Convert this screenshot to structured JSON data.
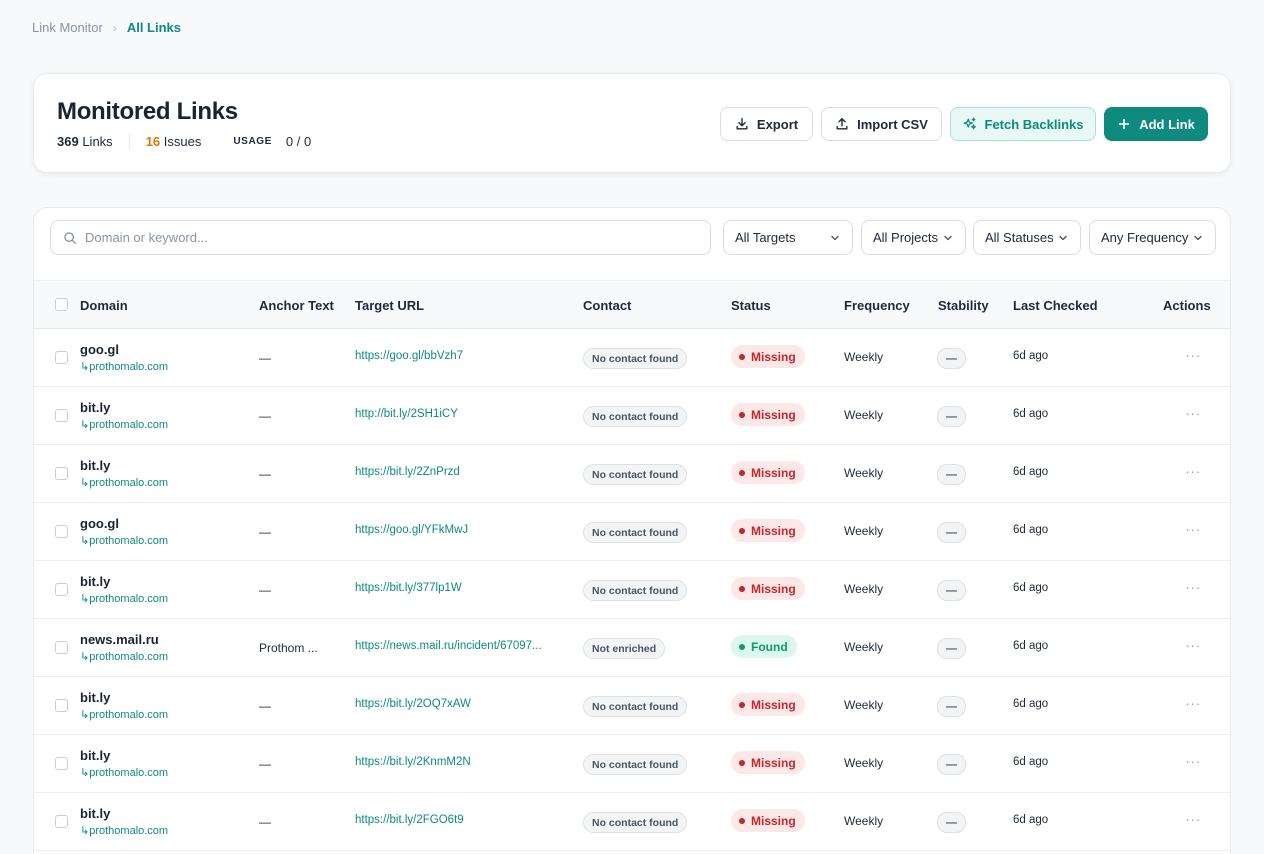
{
  "breadcrumb": {
    "root": "Link Monitor",
    "separator": "›",
    "current": "All Links"
  },
  "header": {
    "title": "Monitored Links",
    "links_count": "369",
    "links_label": "Links",
    "issues_count": "16",
    "issues_label": "Issues",
    "usage_label": "USAGE",
    "usage_value": "0 / 0"
  },
  "actions": {
    "export": "Export",
    "import": "Import CSV",
    "fetch": "Fetch Backlinks",
    "add": "Add Link"
  },
  "filters": {
    "search_placeholder": "Domain or keyword...",
    "targets": "All Targets",
    "projects": "All Projects",
    "statuses": "All Statuses",
    "frequency": "Any Frequency"
  },
  "table": {
    "columns": [
      "Domain",
      "Anchor Text",
      "Target URL",
      "Contact",
      "Status",
      "Frequency",
      "Stability",
      "Last Checked",
      "Actions"
    ],
    "rows": [
      {
        "domain": "goo.gl",
        "sub": "↳prothomalo.com",
        "anchor": "—",
        "target": "https://goo.gl/bbVzh7",
        "contact": "No contact found",
        "status": "Missing",
        "status_type": "missing",
        "frequency": "Weekly",
        "stability": "—",
        "checked": "6d ago"
      },
      {
        "domain": "bit.ly",
        "sub": "↳prothomalo.com",
        "anchor": "—",
        "target": "http://bit.ly/2SH1iCY",
        "contact": "No contact found",
        "status": "Missing",
        "status_type": "missing",
        "frequency": "Weekly",
        "stability": "—",
        "checked": "6d ago"
      },
      {
        "domain": "bit.ly",
        "sub": "↳prothomalo.com",
        "anchor": "—",
        "target": "https://bit.ly/2ZnPrzd",
        "contact": "No contact found",
        "status": "Missing",
        "status_type": "missing",
        "frequency": "Weekly",
        "stability": "—",
        "checked": "6d ago"
      },
      {
        "domain": "goo.gl",
        "sub": "↳prothomalo.com",
        "anchor": "—",
        "target": "https://goo.gl/YFkMwJ",
        "contact": "No contact found",
        "status": "Missing",
        "status_type": "missing",
        "frequency": "Weekly",
        "stability": "—",
        "checked": "6d ago"
      },
      {
        "domain": "bit.ly",
        "sub": "↳prothomalo.com",
        "anchor": "—",
        "target": "https://bit.ly/377lp1W",
        "contact": "No contact found",
        "status": "Missing",
        "status_type": "missing",
        "frequency": "Weekly",
        "stability": "—",
        "checked": "6d ago"
      },
      {
        "domain": "news.mail.ru",
        "sub": "↳prothomalo.com",
        "anchor": "Prothom ...",
        "target": "https://news.mail.ru/incident/67097...",
        "contact": "Not enriched",
        "status": "Found",
        "status_type": "found",
        "frequency": "Weekly",
        "stability": "—",
        "checked": "6d ago"
      },
      {
        "domain": "bit.ly",
        "sub": "↳prothomalo.com",
        "anchor": "—",
        "target": "https://bit.ly/2OQ7xAW",
        "contact": "No contact found",
        "status": "Missing",
        "status_type": "missing",
        "frequency": "Weekly",
        "stability": "—",
        "checked": "6d ago"
      },
      {
        "domain": "bit.ly",
        "sub": "↳prothomalo.com",
        "anchor": "—",
        "target": "https://bit.ly/2KnmM2N",
        "contact": "No contact found",
        "status": "Missing",
        "status_type": "missing",
        "frequency": "Weekly",
        "stability": "—",
        "checked": "6d ago"
      },
      {
        "domain": "bit.ly",
        "sub": "↳prothomalo.com",
        "anchor": "—",
        "target": "https://bit.ly/2FGO6t9",
        "contact": "No contact found",
        "status": "Missing",
        "status_type": "missing",
        "frequency": "Weekly",
        "stability": "—",
        "checked": "6d ago"
      }
    ],
    "row_actions_glyph": "···"
  },
  "colors": {
    "accent": "#0f8a7e",
    "issues": "#d97706",
    "missing": "#c2262e",
    "found": "#0f9a6b"
  }
}
